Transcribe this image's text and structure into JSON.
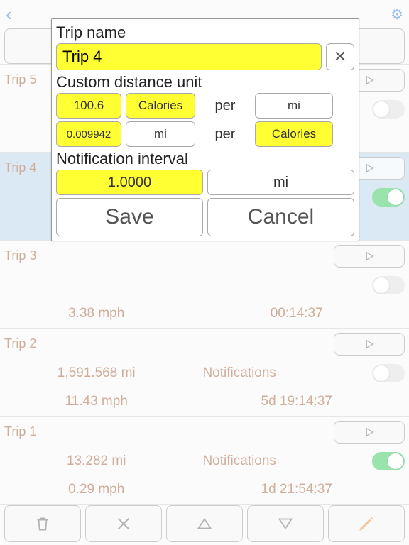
{
  "topbar": {
    "back_glyph": "‹",
    "settings_glyph": "⚙"
  },
  "modal": {
    "trip_name_label": "Trip name",
    "trip_name_value": "Trip 4",
    "clear_glyph": "✕",
    "custom_unit_label": "Custom distance unit",
    "row1": {
      "value": "100.6",
      "unit1": "Calories",
      "per": "per",
      "unit2": "mi"
    },
    "row2": {
      "value": "0.009942",
      "unit1": "mi",
      "per": "per",
      "unit2": "Calories"
    },
    "interval_label": "Notification interval",
    "interval_value": "1.0000",
    "interval_unit": "mi",
    "save_label": "Save",
    "cancel_label": "Cancel"
  },
  "trips": [
    {
      "name": "Trip 5"
    },
    {
      "name": "Trip 4",
      "selected": true,
      "notif_on": true
    },
    {
      "name": "Trip 3",
      "dist": "",
      "speed": "3.38 mph",
      "notif_label": "",
      "notif_on": false,
      "time": "00:14:37"
    },
    {
      "name": "Trip 2",
      "dist": "1,591.568 mi",
      "speed": "11.43 mph",
      "notif_label": "Notifications",
      "notif_on": false,
      "time": "5d 19:14:37"
    },
    {
      "name": "Trip 1",
      "dist": "13.282 mi",
      "speed": "0.29 mph",
      "notif_label": "Notifications",
      "notif_on": true,
      "time": "1d 21:54:37"
    }
  ],
  "labels": {
    "notifications": "Notifications"
  }
}
